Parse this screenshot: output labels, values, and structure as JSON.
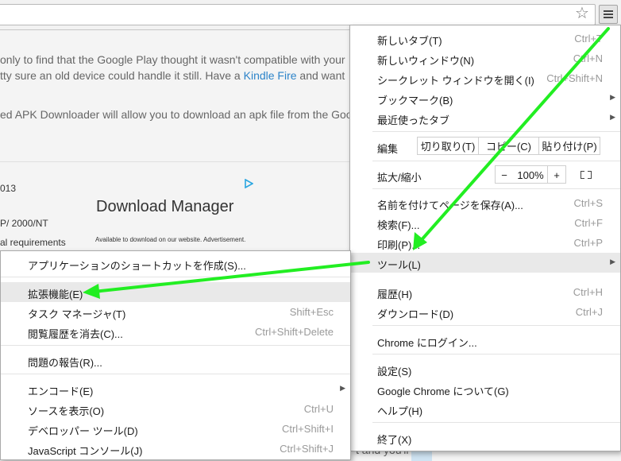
{
  "page": {
    "line1": "only to find that the Google Play thought it wasn't compatible with your",
    "line2_pre": "tty sure an old device could handle it still. Have a ",
    "line2_link": "Kindle Fire",
    "line2_post": " and want",
    "line3": "ed APK Downloader will allow you to download an apk file from the Goo",
    "year": "013",
    "os": "P/ 2000/NT",
    "req": "al requirements",
    "ad_title": "Download Manager",
    "ad_note": "Available to download on our website. Advertisement.",
    "bottom_text": "t and you'll"
  },
  "menu": {
    "new_tab": {
      "label": "新しいタブ(T)",
      "shortcut": "Ctrl+T"
    },
    "new_window": {
      "label": "新しいウィンドウ(N)",
      "shortcut": "Ctrl+N"
    },
    "incognito": {
      "label": "シークレット ウィンドウを開く(I)",
      "shortcut": "Ctrl+Shift+N"
    },
    "bookmarks": {
      "label": "ブックマーク(B)"
    },
    "recent_tabs": {
      "label": "最近使ったタブ"
    },
    "edit": {
      "label": "編集",
      "cut": "切り取り(T)",
      "copy": "コピー(C)",
      "paste": "貼り付け(P)"
    },
    "zoom": {
      "label": "拡大/縮小",
      "minus": "−",
      "value": "100%",
      "plus": "+"
    },
    "save_page": {
      "label": "名前を付けてページを保存(A)...",
      "shortcut": "Ctrl+S"
    },
    "find": {
      "label": "検索(F)...",
      "shortcut": "Ctrl+F"
    },
    "print": {
      "label": "印刷(P)...",
      "shortcut": "Ctrl+P"
    },
    "tools": {
      "label": "ツール(L)"
    },
    "history": {
      "label": "履歴(H)",
      "shortcut": "Ctrl+H"
    },
    "downloads": {
      "label": "ダウンロード(D)",
      "shortcut": "Ctrl+J"
    },
    "signin": {
      "label": "Chrome にログイン..."
    },
    "settings": {
      "label": "設定(S)"
    },
    "about": {
      "label": "Google Chrome について(G)"
    },
    "help": {
      "label": "ヘルプ(H)"
    },
    "exit": {
      "label": "終了(X)"
    }
  },
  "submenu": {
    "shortcut_app": {
      "label": "アプリケーションのショートカットを作成(S)..."
    },
    "extensions": {
      "label": "拡張機能(E)"
    },
    "task_manager": {
      "label": "タスク マネージャ(T)",
      "shortcut": "Shift+Esc"
    },
    "clear_history": {
      "label": "閲覧履歴を消去(C)...",
      "shortcut": "Ctrl+Shift+Delete"
    },
    "report_issue": {
      "label": "問題の報告(R)..."
    },
    "encoding": {
      "label": "エンコード(E)"
    },
    "view_source": {
      "label": "ソースを表示(O)",
      "shortcut": "Ctrl+U"
    },
    "dev_tools": {
      "label": "デベロッパー ツール(D)",
      "shortcut": "Ctrl+Shift+I"
    },
    "js_console": {
      "label": "JavaScript コンソール(J)",
      "shortcut": "Ctrl+Shift+J"
    }
  },
  "colors": {
    "annotation_arrow": "#22ee22",
    "highlight": "#e9e9e9"
  },
  "icons": {
    "star": "star-icon",
    "menu": "hamburger-menu-icon",
    "fullscreen": "fullscreen-icon",
    "adchoices": "adchoices-icon"
  }
}
